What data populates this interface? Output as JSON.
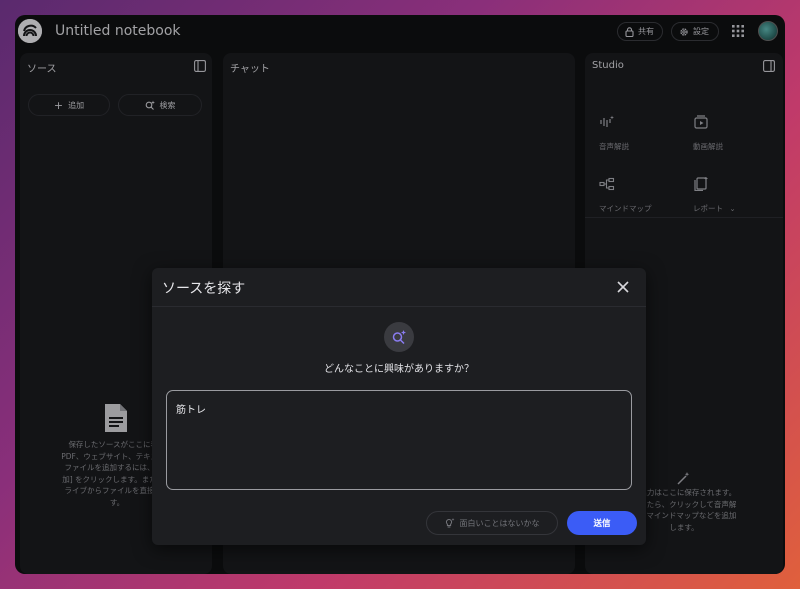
{
  "app": {
    "title": "Untitled notebook"
  },
  "header": {
    "share_label": "共有",
    "settings_label": "設定"
  },
  "sources": {
    "title": "ソース",
    "add_label": "追加",
    "search_label": "検索",
    "empty_lines": [
      "保存したソースがここに表示",
      "PDF、ウェブサイト、テキスト、",
      "ファイルを追加するには、上の",
      "加] をクリックします。または、",
      "ライブからファイルを直接イン",
      "す。"
    ]
  },
  "chat": {
    "title": "チャット"
  },
  "studio": {
    "title": "Studio",
    "tiles": [
      {
        "label": "音声解説",
        "icon": "audio-waveform-icon"
      },
      {
        "label": "動画解説",
        "icon": "video-play-icon"
      },
      {
        "label": "マインドマップ",
        "icon": "mind-map-icon"
      },
      {
        "label": "レポート",
        "icon": "report-add-icon"
      }
    ],
    "empty_lines": [
      "の出力はここに保存されます。",
      "加したら、クリックして音声解",
      "ド、マインドマップなどを追加",
      "します。"
    ]
  },
  "modal": {
    "title": "ソースを探す",
    "question": "どんなことに興味がありますか？",
    "input_value": "筋トレ",
    "suggestion_label": "面白いことはないかな",
    "send_label": "送信"
  },
  "colors": {
    "accent": "#3b5cf6",
    "panel": "#1a1b1e",
    "window": "#0f1012"
  }
}
